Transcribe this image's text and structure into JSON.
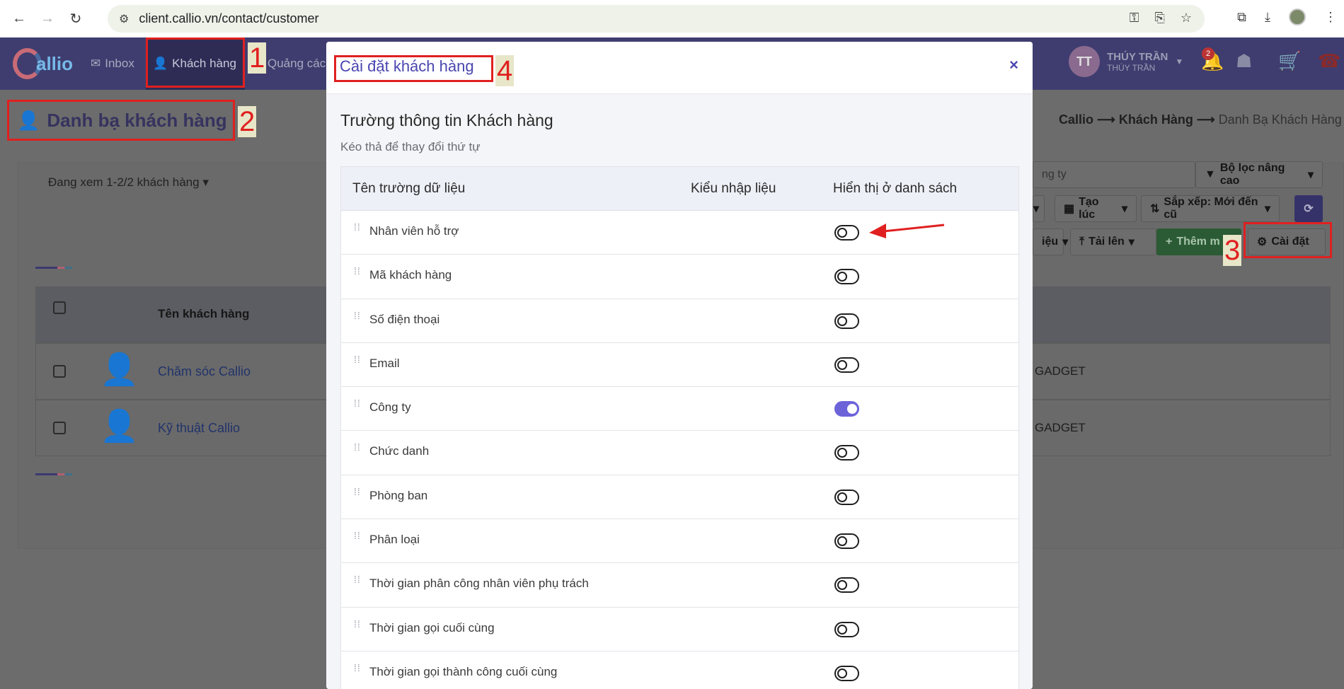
{
  "browser": {
    "url": "client.callio.vn/contact/customer"
  },
  "topnav": {
    "items": [
      {
        "label": "Inbox"
      },
      {
        "label": "Khách hàng"
      },
      {
        "label": "Quảng các"
      }
    ],
    "user_name": "THÚY TRẦN",
    "user_sub": "THÚY TRẦN",
    "user_initials": "TT",
    "notification_count": "2"
  },
  "annotations": [
    "1",
    "2",
    "3",
    "4"
  ],
  "page": {
    "title": "Danh bạ khách hàng",
    "breadcrumb": [
      "Callio",
      "Khách Hàng",
      "Danh Bạ Khách Hàng"
    ],
    "viewing": "Đang xem 1-2/2 khách hàng",
    "search_placeholder": "ng ty",
    "buttons": {
      "advanced_filter": "Bộ lọc nâng cao",
      "created": "Tạo lúc",
      "sort": "Sắp xếp: Mới đến cũ",
      "data": "iệu",
      "upload": "Tải lên",
      "add": "Thêm m",
      "settings": "Cài đặt"
    },
    "table": {
      "header_name": "Tên khách hàng",
      "rows": [
        {
          "name": "Chăm sóc Callio",
          "company": "GADGET"
        },
        {
          "name": "Kỹ thuật Callio",
          "company": "GADGET"
        }
      ]
    }
  },
  "modal": {
    "title": "Cài đặt khách hàng",
    "section_title": "Trường thông tin Khách hàng",
    "hint": "Kéo thả để thay đổi thứ tự",
    "columns": [
      "Tên trường dữ liệu",
      "Kiểu nhập liệu",
      "Hiển thị ở danh sách"
    ],
    "fields": [
      {
        "label": "Nhân viên hỗ trợ",
        "shown": false
      },
      {
        "label": "Mã khách hàng",
        "shown": false
      },
      {
        "label": "Số điện thoại",
        "shown": false
      },
      {
        "label": "Email",
        "shown": false
      },
      {
        "label": "Công ty",
        "shown": true
      },
      {
        "label": "Chức danh",
        "shown": false
      },
      {
        "label": "Phòng ban",
        "shown": false
      },
      {
        "label": "Phân loại",
        "shown": false
      },
      {
        "label": "Thời gian phân công nhân viên phụ trách",
        "shown": false
      },
      {
        "label": "Thời gian gọi cuối cùng",
        "shown": false
      },
      {
        "label": "Thời gian gọi thành công cuối cùng",
        "shown": false
      }
    ]
  },
  "colors": {
    "accent": "#6c63d9",
    "annotation_red": "#e02020",
    "nav_bg": "#3f3d6f"
  }
}
